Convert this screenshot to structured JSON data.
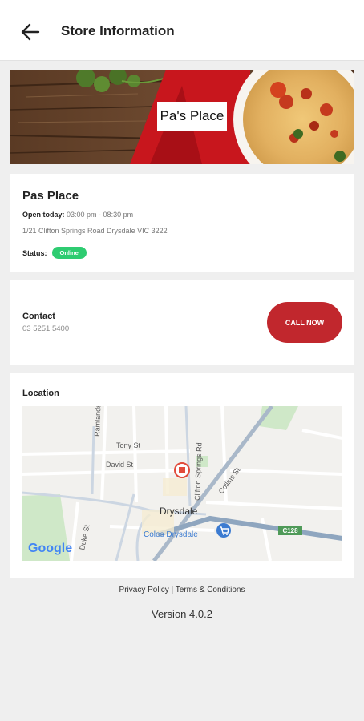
{
  "appbar": {
    "title": "Store Information",
    "back_icon": "arrow-back-icon"
  },
  "banner": {
    "label": "Pa's Place"
  },
  "store": {
    "name": "Pas Place",
    "open_label": "Open today:",
    "hours": "03:00 pm - 08:30 pm",
    "address": "1/21 Clifton Springs Road Drysdale VIC 3222",
    "status_label": "Status:",
    "status_value": "Online",
    "status_color": "#2ecc71"
  },
  "contact": {
    "label": "Contact",
    "phone": "03 5251 5400",
    "call_label": "CALL NOW",
    "call_color": "#c1272d"
  },
  "location": {
    "label": "Location",
    "map": {
      "streets": [
        "Tony St",
        "David St",
        "Ramlands Ln",
        "Clifton Springs Rd",
        "Collins St",
        "Duke St"
      ],
      "town": "Drysdale",
      "poi": "Coles Drysdale",
      "route": "C128",
      "brand": "Google"
    }
  },
  "footer": {
    "privacy": "Privacy Policy",
    "separator": " | ",
    "terms": "Terms & Conditions",
    "version": "Version 4.0.2"
  }
}
